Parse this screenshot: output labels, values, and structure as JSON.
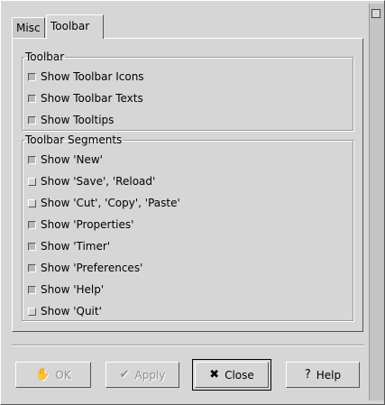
{
  "tabs": [
    {
      "label": "Misc",
      "active": false
    },
    {
      "label": "Toolbar",
      "active": true
    }
  ],
  "toolbar_frame": {
    "title": "Toolbar",
    "items": [
      {
        "label": "Show Toolbar Icons",
        "checked": true
      },
      {
        "label": "Show Toolbar Texts",
        "checked": true
      },
      {
        "label": "Show Tooltips",
        "checked": true
      }
    ]
  },
  "segments_frame": {
    "title": "Toolbar Segments",
    "items": [
      {
        "label": "Show 'New'",
        "checked": true
      },
      {
        "label": "Show 'Save', 'Reload'",
        "checked": false
      },
      {
        "label": "Show 'Cut', 'Copy', 'Paste'",
        "checked": false
      },
      {
        "label": "Show 'Properties'",
        "checked": true
      },
      {
        "label": "Show 'Timer'",
        "checked": true
      },
      {
        "label": "Show 'Preferences'",
        "checked": true
      },
      {
        "label": "Show 'Help'",
        "checked": true
      },
      {
        "label": "Show 'Quit'",
        "checked": false
      }
    ]
  },
  "buttons": {
    "ok": {
      "label": "OK",
      "icon": "ok-hand-icon",
      "enabled": false
    },
    "apply": {
      "label": "Apply",
      "icon": "check-icon",
      "enabled": false
    },
    "close": {
      "label": "Close",
      "icon": "x-icon",
      "enabled": true
    },
    "help": {
      "label": "Help",
      "icon": "question-icon",
      "enabled": true
    }
  },
  "icons": {
    "ok": "✋",
    "apply": "✔",
    "close": "✖",
    "help": "?"
  },
  "colors": {
    "background": "#d6d6d6",
    "disabled_text": "#8e8e8e"
  }
}
